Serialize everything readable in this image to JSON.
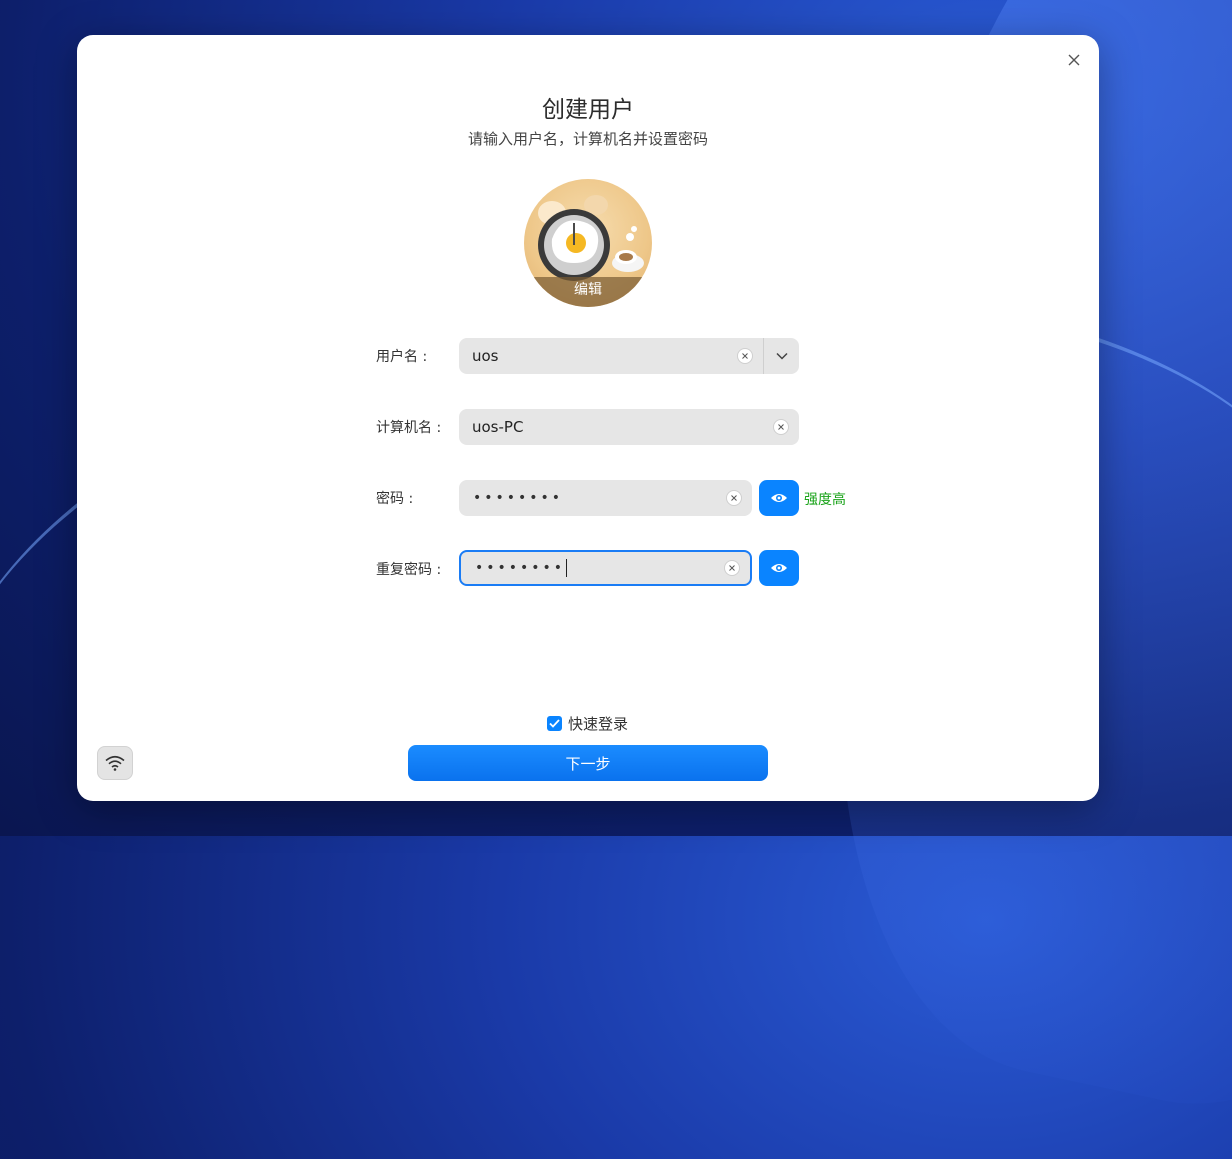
{
  "dialog": {
    "title": "创建用户",
    "subtitle": "请输入用户名，计算机名并设置密码",
    "close_icon": "close-icon"
  },
  "avatar": {
    "edit_label": "编辑",
    "image": "fried-egg-clock-and-coffee-illustration"
  },
  "form": {
    "username": {
      "label": "用户名 :",
      "value": "uos"
    },
    "hostname": {
      "label": "计算机名 :",
      "value": "uos-PC"
    },
    "password": {
      "label": "密码 :",
      "masked": "••••••••",
      "strength": "强度高"
    },
    "repeat_password": {
      "label": "重复密码 :",
      "masked": "••••••••"
    }
  },
  "quick_login": {
    "label": "快速登录",
    "checked": true
  },
  "next_button": {
    "label": "下一步"
  },
  "colors": {
    "accent": "#0a84ff",
    "strength_good": "#19a319"
  },
  "icons": [
    "close-icon",
    "clear-icon",
    "chevron-down-icon",
    "eye-icon",
    "checkbox-checked-icon",
    "wifi-icon"
  ]
}
